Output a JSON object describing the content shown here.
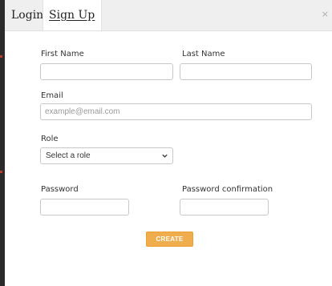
{
  "tabs": [
    {
      "label": "Login",
      "active": false
    },
    {
      "label": "Sign Up",
      "active": true
    }
  ],
  "close_label": "×",
  "form": {
    "first_name": {
      "label": "First Name",
      "value": "",
      "placeholder": ""
    },
    "last_name": {
      "label": "Last Name",
      "value": "",
      "placeholder": ""
    },
    "email": {
      "label": "Email",
      "value": "",
      "placeholder": "example@email.com"
    },
    "role": {
      "label": "Role",
      "selected": "Select a role"
    },
    "password": {
      "label": "Password",
      "value": ""
    },
    "password_confirmation": {
      "label": "Password confirmation",
      "value": ""
    },
    "submit_label": "CREATE"
  },
  "colors": {
    "accent": "#f0ad4e",
    "tabbar_bg": "#efefef"
  },
  "icons": {
    "close": "close-icon",
    "dropdown": "chevron-down-icon"
  }
}
